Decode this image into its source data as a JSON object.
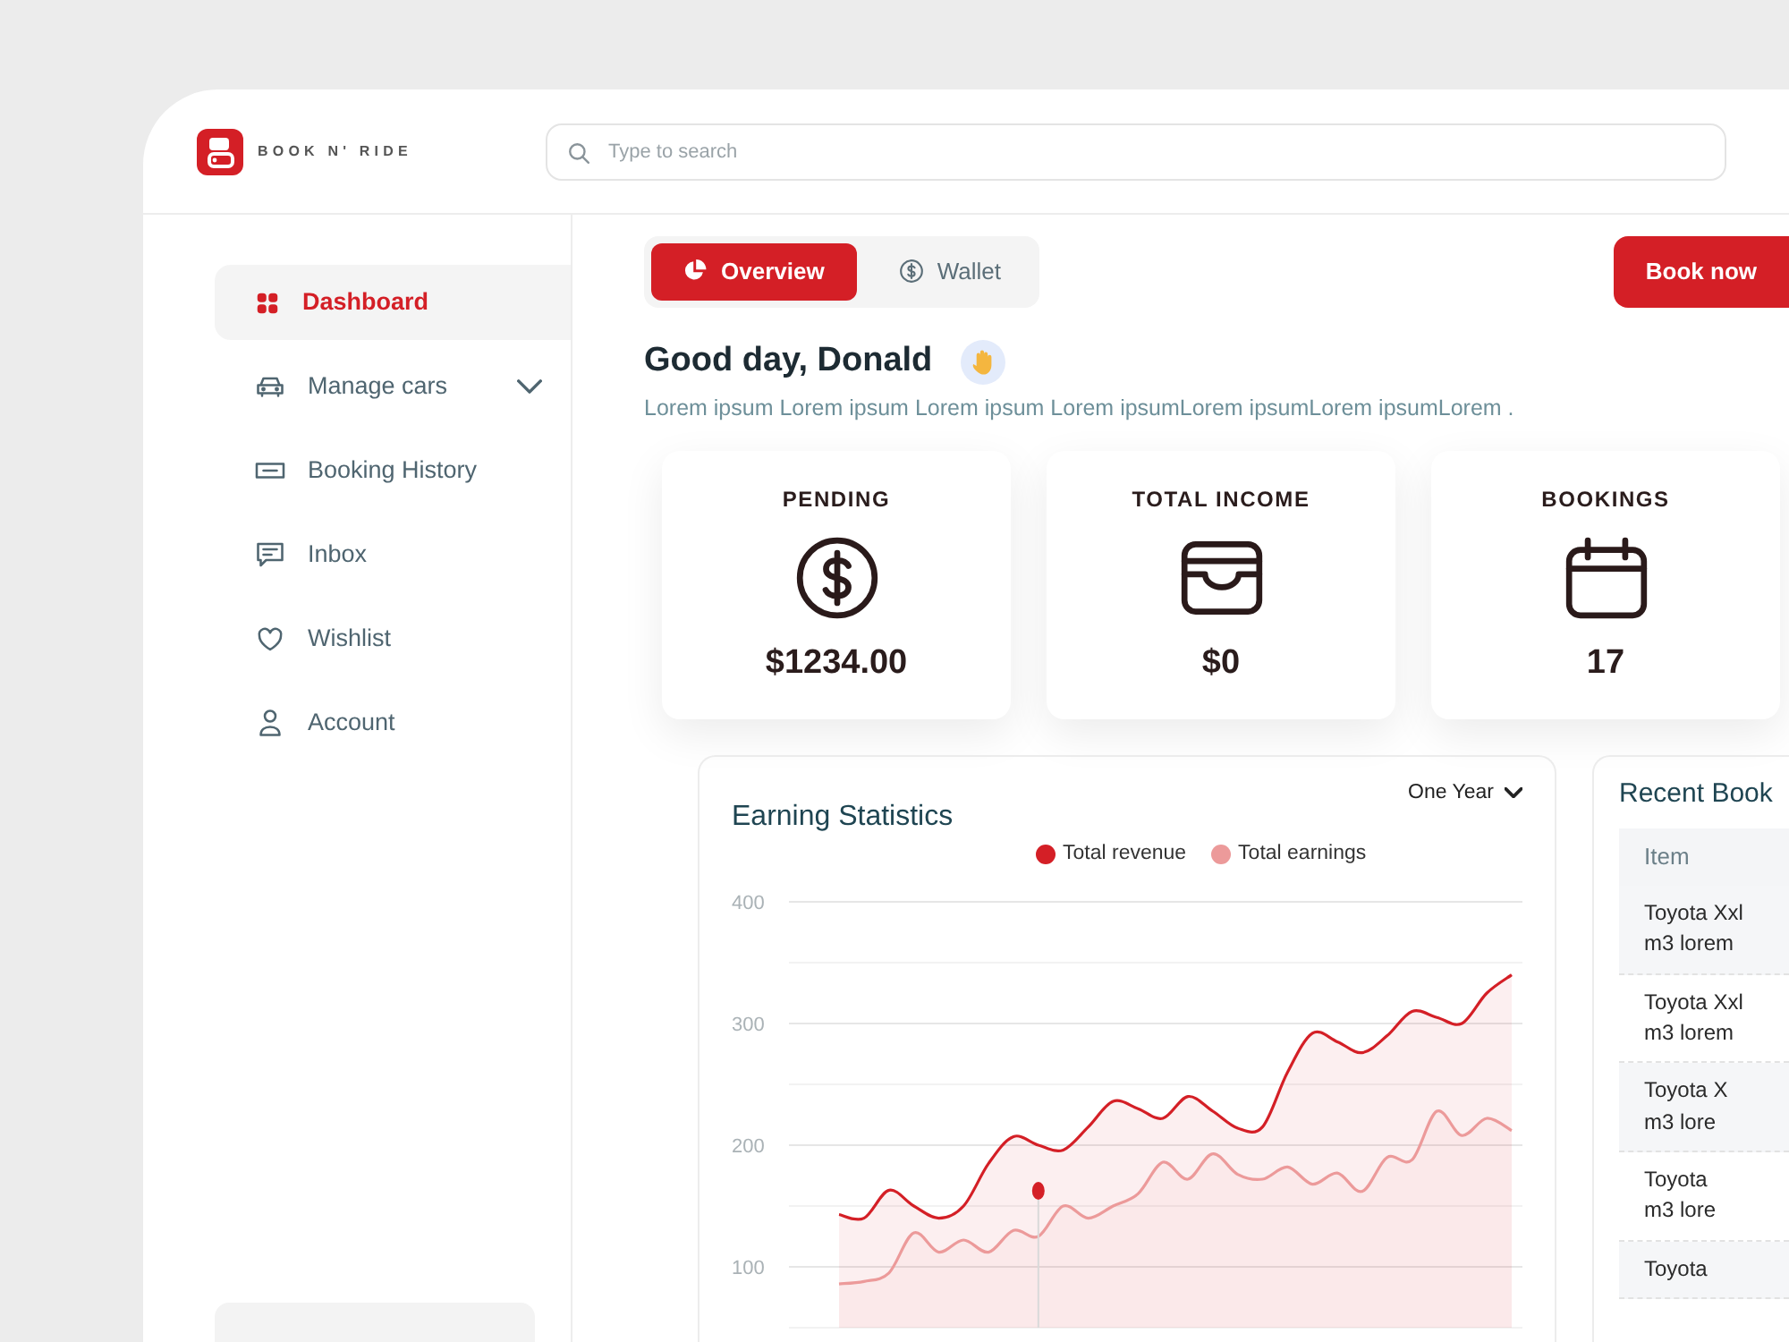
{
  "header": {
    "brand": "BOOK N' RIDE",
    "search": {
      "placeholder": "Type to search"
    }
  },
  "sidebar": {
    "items": [
      {
        "label": "Dashboard",
        "selected": true
      },
      {
        "label": "Manage cars",
        "selected": false,
        "expanded": false
      },
      {
        "label": "Booking History",
        "selected": false
      },
      {
        "label": "Inbox",
        "selected": false
      },
      {
        "label": "Wishlist",
        "selected": false
      },
      {
        "label": "Account",
        "selected": false
      }
    ]
  },
  "tabs": [
    {
      "label": "Overview",
      "selected": true
    },
    {
      "label": "Wallet",
      "selected": false
    }
  ],
  "book_button": {
    "label": "Book now"
  },
  "greeting": {
    "title": "Good day, Donald",
    "subtitle": "Lorem ipsum Lorem ipsum Lorem ipsum Lorem ipsumLorem ipsumLorem ipsumLorem ."
  },
  "stats": [
    {
      "label": "PENDING",
      "value": "$1234.00"
    },
    {
      "label": "TOTAL INCOME",
      "value": "$0"
    },
    {
      "label": "BOOKINGS",
      "value": "17"
    }
  ],
  "earning_statistics": {
    "period": "One Year",
    "hover_marker": true,
    "chart_data": {
      "type": "area",
      "title": "Earning Statistics",
      "series": [
        {
          "name": "Total revenue",
          "color": "#d41f26",
          "values": [
            143,
            140,
            163,
            150,
            140,
            150,
            185,
            207,
            200,
            196,
            215,
            236,
            230,
            222,
            240,
            228,
            214,
            215,
            260,
            292,
            285,
            276,
            290,
            310,
            305,
            300,
            325,
            340
          ]
        },
        {
          "name": "Total earnings",
          "color": "#ec9a9a",
          "values": [
            86,
            88,
            95,
            128,
            112,
            122,
            112,
            130,
            125,
            150,
            140,
            150,
            160,
            186,
            172,
            193,
            176,
            172,
            182,
            168,
            177,
            162,
            190,
            188,
            228,
            208,
            222,
            212
          ]
        }
      ],
      "ylim": [
        50,
        400
      ],
      "yticks": [
        100,
        200,
        300,
        400
      ],
      "grid": true
    }
  },
  "recent_bookings": {
    "title": "Recent Book",
    "columns": [
      "Item"
    ],
    "rows": [
      {
        "item": "Toyota Xxl",
        "detail": "m3 lorem"
      },
      {
        "item": "Toyota Xxl",
        "detail": "m3 lorem"
      },
      {
        "item": "Toyota X",
        "detail": "m3 lore"
      },
      {
        "item": "Toyota",
        "detail": "m3 lore"
      },
      {
        "item": "Toyota"
      }
    ]
  }
}
